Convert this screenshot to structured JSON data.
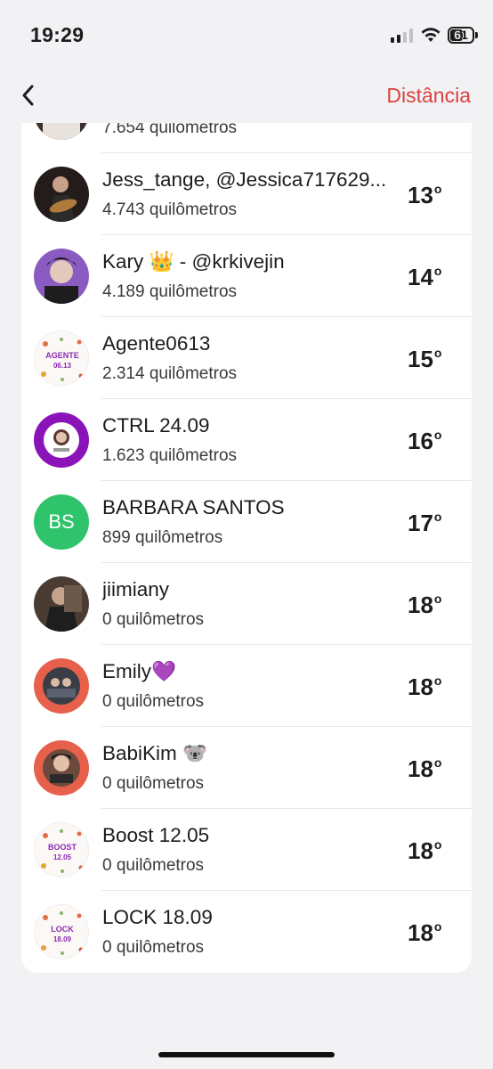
{
  "status_bar": {
    "time": "19:29",
    "battery": "61"
  },
  "nav": {
    "action_label": "Distância"
  },
  "partial_row": {
    "distance": "7.654 quilômetros"
  },
  "rows": [
    {
      "name": "Jess_tange, @Jessica717629...",
      "distance": "4.743 quilômetros",
      "rank": "13",
      "suffix": "o"
    },
    {
      "name": "Kary 👑 - @krkivejin",
      "distance": "4.189 quilômetros",
      "rank": "14",
      "suffix": "o"
    },
    {
      "name": "Agente0613",
      "distance": "2.314 quilômetros",
      "rank": "15",
      "suffix": "o",
      "avatar_text": [
        "AGENTE",
        "06.13"
      ]
    },
    {
      "name": "CTRL 24.09",
      "distance": "1.623 quilômetros",
      "rank": "16",
      "suffix": "o"
    },
    {
      "name": "BARBARA SANTOS",
      "distance": "899 quilômetros",
      "rank": "17",
      "suffix": "o",
      "initials": "BS"
    },
    {
      "name": "jiimiany",
      "distance": "0 quilômetros",
      "rank": "18",
      "suffix": "o"
    },
    {
      "name": "Emily💜",
      "distance": "0 quilômetros",
      "rank": "18",
      "suffix": "o"
    },
    {
      "name": "BabiKim 🐨",
      "distance": "0 quilômetros",
      "rank": "18",
      "suffix": "o"
    },
    {
      "name": "Boost 12.05",
      "distance": "0 quilômetros",
      "rank": "18",
      "suffix": "o",
      "avatar_text": [
        "BOOST",
        "12.05"
      ]
    },
    {
      "name": "LOCK 18.09",
      "distance": "0 quilômetros",
      "rank": "18",
      "suffix": "o",
      "avatar_text": [
        "LOCK",
        "18.09"
      ]
    }
  ],
  "colors": {
    "accent": "#d9423f",
    "initials_avatar": "#2fc46b",
    "ctrl_avatar": "#8a14b8",
    "coral_avatar": "#e7604c",
    "badge_text": "#8b2bb0"
  }
}
